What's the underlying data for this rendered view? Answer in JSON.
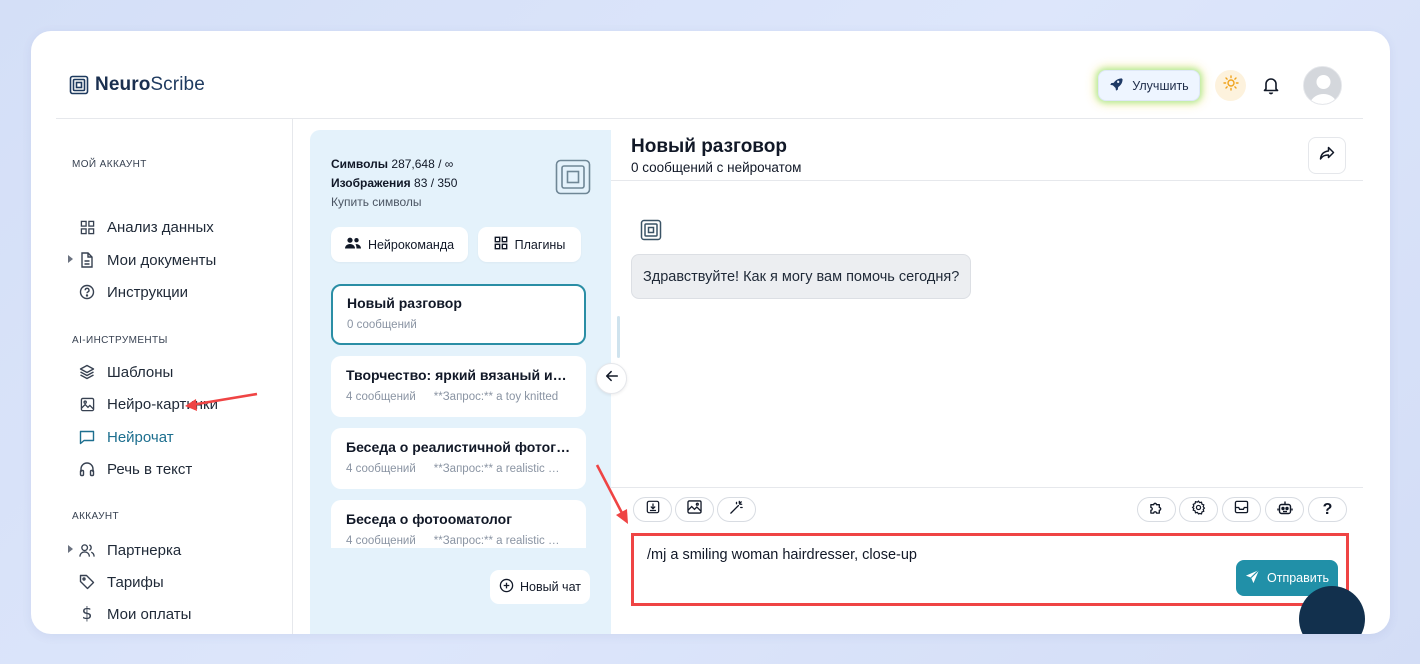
{
  "brand": {
    "name_bold": "Neuro",
    "name_rest": "Scribe"
  },
  "header": {
    "upgrade_label": "Улучшить"
  },
  "sidebar": {
    "sections": [
      {
        "title": "МОЙ АККАУНТ"
      },
      {
        "title": "AI-ИНСТРУМЕНТЫ"
      },
      {
        "title": "АККАУНТ"
      }
    ],
    "items": [
      {
        "label": "Анализ данных",
        "icon": "grid-icon"
      },
      {
        "label": "Мои документы",
        "icon": "document-icon"
      },
      {
        "label": "Инструкции",
        "icon": "help-circle-icon"
      },
      {
        "label": "Шаблоны",
        "icon": "layers-icon"
      },
      {
        "label": "Нейро-картинки",
        "icon": "image-icon"
      },
      {
        "label": "Нейрочат",
        "icon": "chat-icon"
      },
      {
        "label": "Речь в текст",
        "icon": "headphones-icon"
      },
      {
        "label": "Партнерка",
        "icon": "users-icon"
      },
      {
        "label": "Тарифы",
        "icon": "tag-icon"
      },
      {
        "label": "Мои оплаты",
        "icon": "dollar-icon"
      }
    ]
  },
  "stats": {
    "symbols_label": "Символы",
    "symbols_value": "287,648 / ∞",
    "images_label": "Изображения",
    "images_value": "83 / 350",
    "buy_label": "Купить символы"
  },
  "panel_buttons": {
    "team_label": "Нейрокоманда",
    "plugins_label": "Плагины"
  },
  "chats": [
    {
      "title": "Новый разговор",
      "count": "0 сообщений",
      "preview": ""
    },
    {
      "title": "Творчество: яркий вязаный игрушечный",
      "count": "4 сообщений",
      "preview": "**Запрос:** a toy knitted"
    },
    {
      "title": "Беседа о реалистичной фотографии",
      "count": "4 сообщений",
      "preview": "**Запрос:** a realistic photo"
    },
    {
      "title": "Беседа о фотоомато­лог",
      "count": "4 сообщений",
      "preview": "**Запрос:** a realistic photo"
    }
  ],
  "new_chat_label": "Новый чат",
  "conversation": {
    "title": "Новый разговор",
    "subtitle": "0 сообщений с нейрочатом",
    "greeting": "Здравствуйте! Как я могу вам помочь сегодня?",
    "input_value": "/mj a smiling woman hairdresser, close-up",
    "send_label": "Отправить",
    "help_label": "?"
  },
  "colors": {
    "accent": "#2190a8",
    "active_nav": "#1d6f8f",
    "panel_bg": "#e4f2fb",
    "annotation_red": "#ef4444"
  }
}
